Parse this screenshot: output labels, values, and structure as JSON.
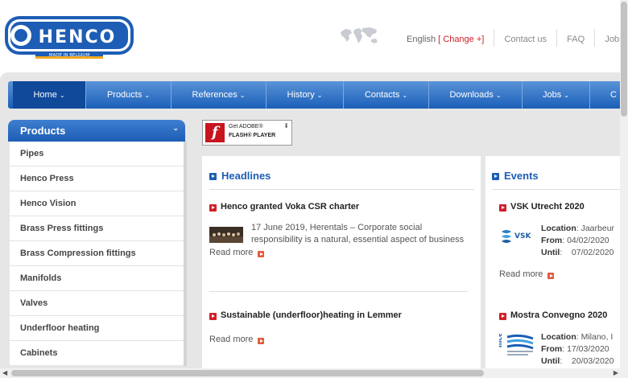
{
  "brand": {
    "name": "HENCO",
    "tagline": "MADE IN BELGIUM"
  },
  "top_links": {
    "language": "English",
    "change": "[ Change +]",
    "contact": "Contact us",
    "faq": "FAQ",
    "jobs": "Jobs"
  },
  "nav": [
    {
      "label": "Home",
      "active": true
    },
    {
      "label": "Products"
    },
    {
      "label": "References"
    },
    {
      "label": "History"
    },
    {
      "label": "Contacts"
    },
    {
      "label": "Downloads"
    },
    {
      "label": "Jobs"
    },
    {
      "label": "C"
    }
  ],
  "sidebar": {
    "title": "Products",
    "items": [
      "Pipes",
      "Henco Press",
      "Henco Vision",
      "Brass Press fittings",
      "Brass Compression fittings",
      "Manifolds",
      "Valves",
      "Underfloor heating",
      "Cabinets"
    ]
  },
  "flash_badge": {
    "line1": "Get ADOBE®",
    "line2": "FLASH® PLAYER"
  },
  "headlines": {
    "title": "Headlines",
    "items": [
      {
        "title": "Henco granted Voka CSR charter",
        "text": "17 June 2019, Herentals – Corporate social responsibility is a natural, essential aspect of business",
        "read_more": "Read more"
      },
      {
        "title": "Sustainable (underfloor)heating in Lemmer",
        "read_more": "Read more"
      }
    ]
  },
  "events": {
    "title": "Events",
    "items": [
      {
        "title": "VSK Utrecht 2020",
        "logo_text": "VSK",
        "location_label": "Location",
        "location": ": Jaarbeur",
        "from_label": "From",
        "from": ": 04/02/2020",
        "until_label": "Until",
        "until": ":    07/02/2020",
        "read_more": "Read more"
      },
      {
        "title": "Mostra Convegno 2020",
        "logo_text": "mce",
        "location_label": "Location",
        "location": ": Milano, I",
        "from_label": "From",
        "from": ": 17/03/2020",
        "until_label": "Until",
        "until": ":    20/03/2020"
      }
    ]
  },
  "colors": {
    "accent_blue": "#1d5db5",
    "accent_red": "#d0202a",
    "panel_gray": "#e6e6e6"
  }
}
